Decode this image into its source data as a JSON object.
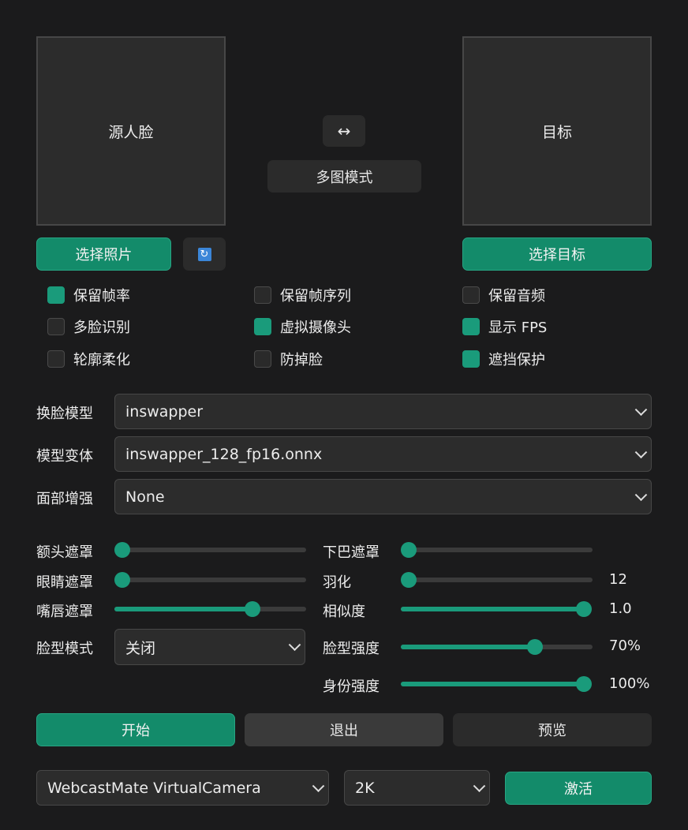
{
  "source_panel": {
    "label": "源人脸"
  },
  "target_panel": {
    "label": "目标"
  },
  "swap_button": {
    "label": "↔"
  },
  "multi_mode_button": {
    "label": "多图模式"
  },
  "select_photo_button": {
    "label": "选择照片"
  },
  "refresh_icon": "refresh-icon",
  "select_target_button": {
    "label": "选择目标"
  },
  "checkboxes": [
    {
      "label": "保留帧率",
      "checked": true
    },
    {
      "label": "保留帧序列",
      "checked": false
    },
    {
      "label": "保留音频",
      "checked": false
    },
    {
      "label": "多脸识别",
      "checked": false
    },
    {
      "label": "虚拟摄像头",
      "checked": true
    },
    {
      "label": "显示 FPS",
      "checked": true
    },
    {
      "label": "轮廓柔化",
      "checked": false
    },
    {
      "label": "防掉脸",
      "checked": false
    },
    {
      "label": "遮挡保护",
      "checked": true
    }
  ],
  "selects": {
    "swap_model": {
      "label": "换脸模型",
      "value": "inswapper"
    },
    "model_variant": {
      "label": "模型变体",
      "value": "inswapper_128_fp16.onnx"
    },
    "face_enhance": {
      "label": "面部增强",
      "value": "None"
    },
    "face_shape_mode": {
      "label": "脸型模式",
      "value": "关闭"
    },
    "camera": {
      "value": "WebcastMate VirtualCamera"
    },
    "resolution": {
      "value": "2K"
    }
  },
  "sliders": {
    "forehead_mask": {
      "label": "额头遮罩",
      "level": 0.0
    },
    "eye_mask": {
      "label": "眼睛遮罩",
      "level": 0.0
    },
    "lip_mask": {
      "label": "嘴唇遮罩",
      "level": 0.72
    },
    "chin_mask": {
      "label": "下巴遮罩",
      "level": 0.0
    },
    "feather": {
      "label": "羽化",
      "level": 0.0,
      "value": "12"
    },
    "similarity": {
      "label": "相似度",
      "level": 1.0,
      "value": "1.0"
    },
    "face_shape_strength": {
      "label": "脸型强度",
      "level": 0.7,
      "value": "70%"
    },
    "identity_strength": {
      "label": "身份强度",
      "level": 1.0,
      "value": "100%"
    }
  },
  "actions": {
    "start": "开始",
    "exit": "退出",
    "preview": "预览",
    "activate": "激活"
  }
}
